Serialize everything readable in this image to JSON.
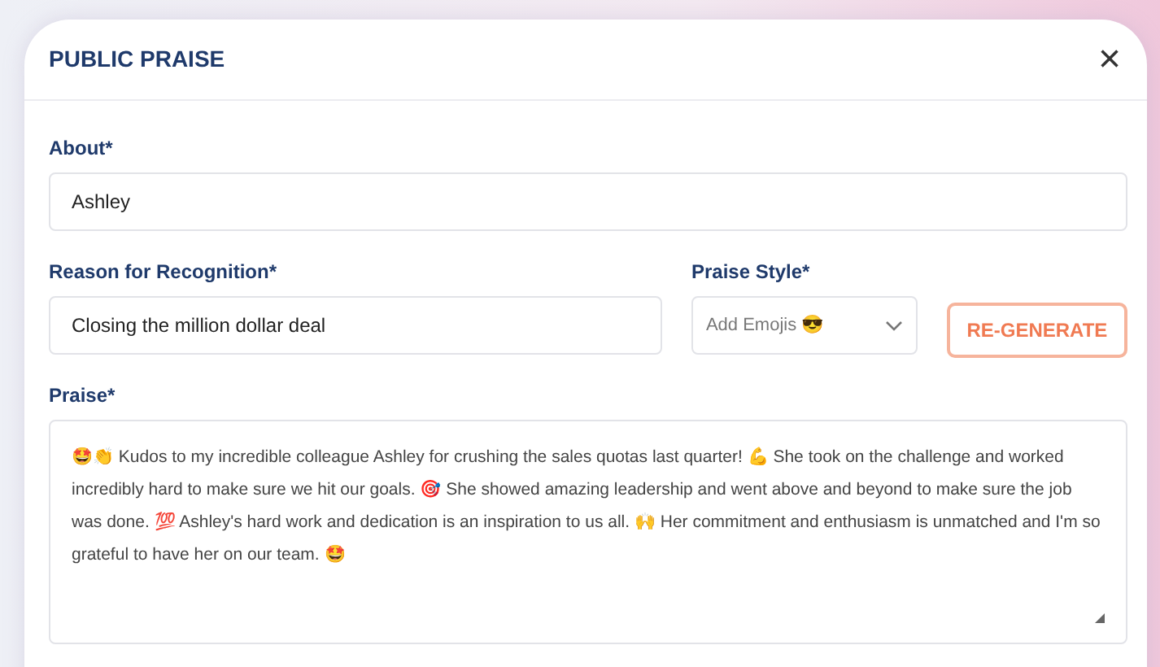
{
  "dialog": {
    "title": "PUBLIC PRAISE",
    "close": "×"
  },
  "about": {
    "label": "About*",
    "value": "Ashley"
  },
  "reason": {
    "label": "Reason for Recognition*",
    "value": "Closing the million dollar deal"
  },
  "praise_style": {
    "label": "Praise Style*",
    "value": "Add Emojis 😎"
  },
  "regenerate_button": "RE-GENERATE",
  "praise": {
    "label": "Praise*",
    "value": "🤩👏 Kudos to my incredible colleague Ashley for crushing the sales quotas last quarter! 💪 She took on the challenge and worked incredibly hard to make sure we hit our goals. 🎯 She showed amazing leadership and went above and beyond to make sure the job was done. 💯 Ashley's hard work and dedication is an inspiration to us all. 🙌 Her commitment and enthusiasm is unmatched and I'm so grateful to have her on our team. 🤩"
  }
}
